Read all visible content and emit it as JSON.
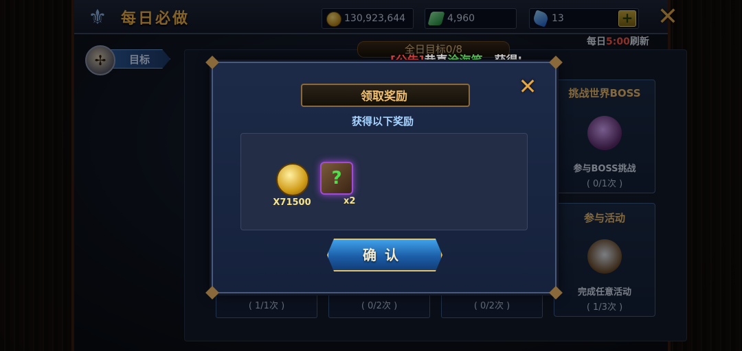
{
  "header": {
    "title": "每日必做",
    "resources": {
      "gold": "130,923,644",
      "jade": "4,960",
      "gem": "13"
    },
    "add_label": "+",
    "close_label": "✕",
    "refresh_prefix": "每日",
    "refresh_time": "5:00",
    "refresh_suffix": "刷新"
  },
  "sidebar": {
    "tab_label": "目标"
  },
  "panel": {
    "header_text": "全日目标0/8",
    "ticker": {
      "tag": "[公告]",
      "text1": "恭喜",
      "name": "沧海笑",
      "text2": "，获得⁝"
    }
  },
  "tasks": [
    {
      "title": "挑战世界BOSS",
      "desc": "参与BOSS挑战",
      "progress": "( 0/1次 )"
    },
    {
      "title": "参与活动",
      "desc": "完成任意活动",
      "progress": "( 1/3次 )"
    }
  ],
  "task_row_progress": [
    "( 1/1次 )",
    "( 0/2次 )",
    "( 0/2次 )"
  ],
  "modal": {
    "title": "领取奖励",
    "subtitle": "获得以下奖励",
    "close_label": "✕",
    "rewards": [
      {
        "icon": "gold-coin-icon",
        "count": "X71500"
      },
      {
        "icon": "mystery-book-icon",
        "count": "x2"
      }
    ],
    "confirm_label": "确认"
  }
}
